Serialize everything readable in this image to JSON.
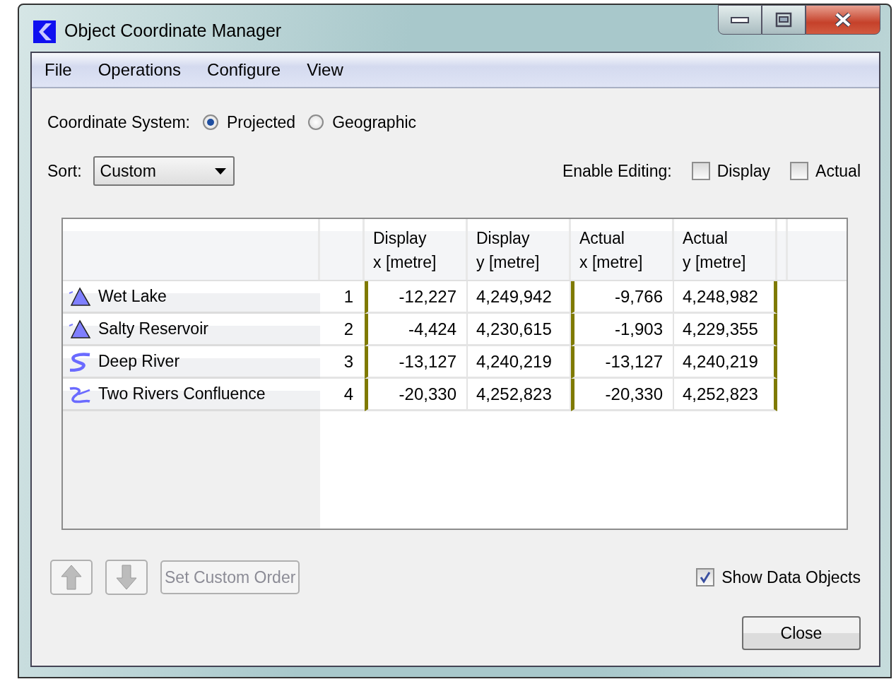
{
  "window": {
    "title": "Object Coordinate Manager"
  },
  "menu": [
    "File",
    "Operations",
    "Configure",
    "View"
  ],
  "coordinate_system": {
    "label": "Coordinate System:",
    "options": [
      {
        "label": "Projected",
        "selected": true
      },
      {
        "label": "Geographic",
        "selected": false
      }
    ]
  },
  "sort": {
    "label": "Sort:",
    "value": "Custom"
  },
  "enable_editing": {
    "label": "Enable Editing:",
    "options": [
      {
        "label": "Display",
        "checked": false
      },
      {
        "label": "Actual",
        "checked": false
      }
    ]
  },
  "table": {
    "columns": [
      "Display\nx [metre]",
      "Display\ny [metre]",
      "Actual\nx [metre]",
      "Actual\ny [metre]"
    ],
    "rows": [
      {
        "kind": "reservoir",
        "name": "Wet Lake",
        "index": "1",
        "values": [
          "-12,227",
          "4,249,942",
          "-9,766",
          "4,248,982"
        ]
      },
      {
        "kind": "reservoir",
        "name": "Salty Reservoir",
        "index": "2",
        "values": [
          "-4,424",
          "4,230,615",
          "-1,903",
          "4,229,355"
        ]
      },
      {
        "kind": "reach",
        "name": "Deep River",
        "index": "3",
        "values": [
          "-13,127",
          "4,240,219",
          "-13,127",
          "4,240,219"
        ]
      },
      {
        "kind": "confluence",
        "name": "Two Rivers Confluence",
        "index": "4",
        "values": [
          "-20,330",
          "4,252,823",
          "-20,330",
          "4,252,823"
        ]
      }
    ]
  },
  "move_up": {
    "disabled": true
  },
  "move_down": {
    "disabled": true
  },
  "set_custom_order": {
    "label": "Set Custom Order",
    "disabled": true
  },
  "show_data_objects": {
    "label": "Show Data Objects",
    "checked": true
  },
  "close_button": "Close"
}
